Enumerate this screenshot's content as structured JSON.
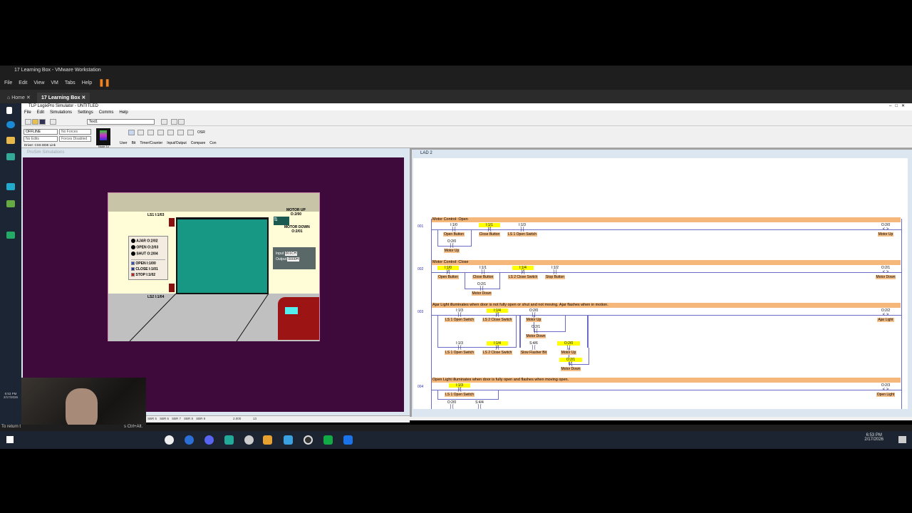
{
  "vmware": {
    "title": "17 Learning Box - VMware Workstation",
    "menu": [
      "File",
      "Edit",
      "View",
      "VM",
      "Tabs",
      "Help"
    ],
    "tabs": [
      "Home",
      "17 Learning Box"
    ]
  },
  "app": {
    "title": "TLP LogixPro Simulator - UNTITLED",
    "menu": [
      "File",
      "Edit",
      "Simulations",
      "Settings",
      "Comms",
      "Help"
    ],
    "rung_text_field": "Text1",
    "mode_select": "OFFLINE",
    "forces_select": "No Forces",
    "edits_select": "No Edits",
    "forces_enabled_select": "Forces Disabled",
    "driver": "Driver: CSS DDE Link",
    "node": "Node 1c",
    "instruction_tabs": [
      "User",
      "Bit",
      "Timer/Counter",
      "Input/Output",
      "Compare",
      "Con"
    ],
    "osr_label": "OSR"
  },
  "sim_window": {
    "title": "ProSim Simulations",
    "labels": {
      "ls1": "LS1  I:1/03",
      "ls2": "LS2  I:1/04",
      "motor_up": "MOTOR UP",
      "motor_up_addr": "O:2/00",
      "motor_down": "MOTOR DOWN",
      "motor_down_addr": "O:2/01",
      "lights": [
        {
          "name": "AJAR",
          "addr": "O:2/02"
        },
        {
          "name": "OPEN",
          "addr": "O:2/03"
        },
        {
          "name": "SHUT",
          "addr": "O:2/04"
        }
      ],
      "buttons": [
        {
          "name": "OPEN",
          "addr": "I:1/00",
          "color": "#3050c0"
        },
        {
          "name": "CLOSE",
          "addr": "I:1/01",
          "color": "#223399"
        },
        {
          "name": "STOP",
          "addr": "I:1/02",
          "color": "#c02020"
        }
      ],
      "io_input_label": "Input",
      "io_input": "001CH",
      "io_output_label": "Output",
      "io_output": "0000H"
    },
    "status_tabs": [
      "SBR 5",
      "SBR 6",
      "SBR 7",
      "SBR 8",
      "SBR 9"
    ],
    "status_value1": "2.000",
    "status_value2": "13"
  },
  "ladder": {
    "title": "LAD 2",
    "rungs": [
      {
        "number": "001",
        "comment": "Motor Control: Open",
        "coil": {
          "addr": "O:2/0",
          "label": "Motor Up"
        },
        "elements": [
          {
            "addr": "I:1/0",
            "label": "Open Button",
            "type": "NO",
            "hl": false
          },
          {
            "addr": "I:1/1",
            "label": "Close Button",
            "type": "NC",
            "hl": true
          },
          {
            "addr": "I:1/3",
            "label": "LS 1 Open Switch",
            "type": "NO",
            "hl": false
          },
          {
            "addr": "O:2/0",
            "label": "Motor Up",
            "type": "NO",
            "hl": false
          }
        ]
      },
      {
        "number": "002",
        "comment": "Motor Control: Close",
        "coil": {
          "addr": "O:2/1",
          "label": "Motor Down"
        },
        "elements": [
          {
            "addr": "I:1/0",
            "label": "Open Button",
            "type": "NC",
            "hl": true
          },
          {
            "addr": "I:1/1",
            "label": "Close Button",
            "type": "NO",
            "hl": false
          },
          {
            "addr": "I:1/4",
            "label": "LS 2 Close Switch",
            "type": "NC",
            "hl": true
          },
          {
            "addr": "I:1/2",
            "label": "Stop Button",
            "type": "NO",
            "hl": false
          },
          {
            "addr": "O:2/1",
            "label": "Motor Down",
            "type": "NO",
            "hl": false
          }
        ]
      },
      {
        "number": "003",
        "comment": "Ajar Light illuminates when door is not fully open or shut and not moving. Ajar flashes when in motion.",
        "coil": {
          "addr": "O:2/2",
          "label": "Ajar Light"
        },
        "elements": [
          {
            "addr": "I:1/3",
            "label": "LS 1 Open Switch",
            "type": "NO",
            "hl": false
          },
          {
            "addr": "I:1/4",
            "label": "LS 2 Close Switch",
            "type": "NC",
            "hl": true
          },
          {
            "addr": "O:2/0",
            "label": "Motor Up",
            "type": "NO",
            "hl": false
          },
          {
            "addr": "O:2/1",
            "label": "Motor Down",
            "type": "NO",
            "hl": false
          },
          {
            "addr": "I:1/3",
            "label": "LS 1 Open Switch",
            "type": "NO",
            "hl": false
          },
          {
            "addr": "I:1/4",
            "label": "LS 2 Close Switch",
            "type": "NC",
            "hl": true
          },
          {
            "addr": "S:4/6",
            "label": "Slow Flasher Bit",
            "type": "NO",
            "hl": false
          },
          {
            "addr": "O:2/0",
            "label": "Motor Up",
            "type": "NO",
            "hl": true
          },
          {
            "addr": "O:2/1",
            "label": "Motor Down",
            "type": "NC",
            "hl": true
          }
        ]
      },
      {
        "number": "004",
        "comment": "Open Light illuminates when door is fully open and flashes when moving open.",
        "coil": {
          "addr": "O:2/3",
          "label": "Open Light"
        },
        "elements": [
          {
            "addr": "I:1/3",
            "label": "LS 1 Open Switch",
            "type": "NC",
            "hl": true
          },
          {
            "addr": "O:2/0",
            "label": "",
            "type": "NO",
            "hl": false
          },
          {
            "addr": "S:4/4",
            "label": "",
            "type": "NO",
            "hl": false
          }
        ]
      }
    ]
  },
  "vm_status": "To return t                                                                                       s Ctrl+Alt.",
  "clock": {
    "time": "6:53 PM",
    "date": "2/17/2026"
  },
  "guest_clock": {
    "time": "6:53 PM",
    "date": "2/17/2026"
  }
}
